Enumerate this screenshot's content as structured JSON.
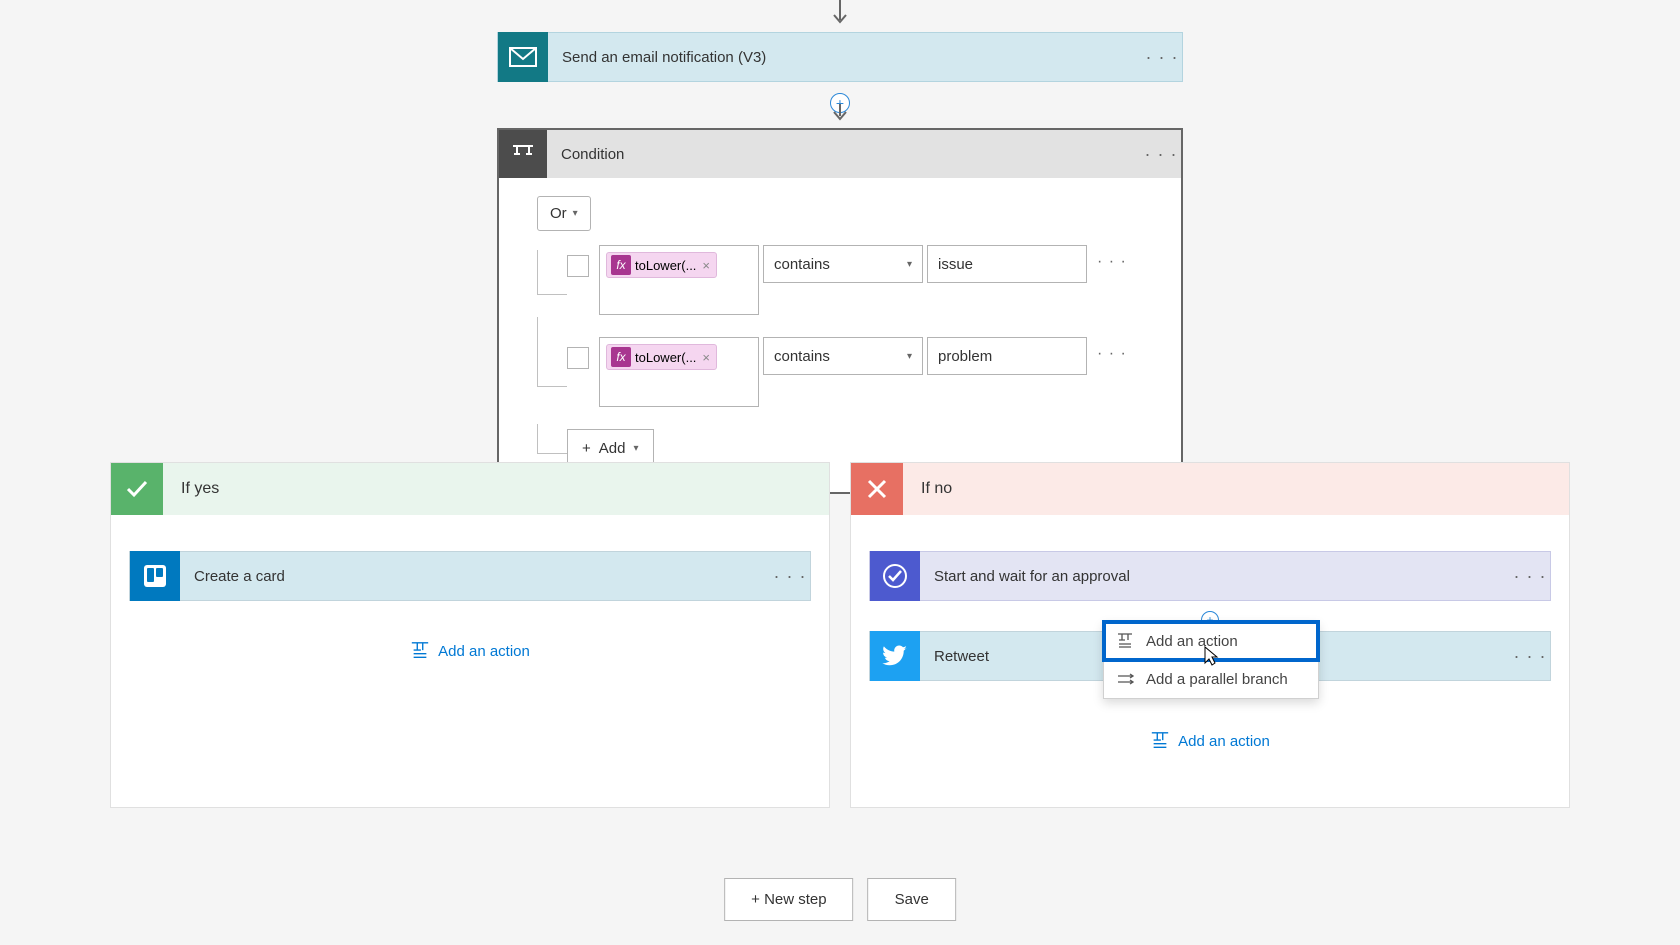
{
  "flow": {
    "step_email": "Send an email notification (V3)",
    "condition": {
      "title": "Condition",
      "logic": "Or",
      "rows": [
        {
          "pill": "toLower(...",
          "operator": "contains",
          "value": "issue"
        },
        {
          "pill": "toLower(...",
          "operator": "contains",
          "value": "problem"
        }
      ],
      "add_label": "Add"
    },
    "branches": {
      "yes": {
        "title": "If yes",
        "actions": [
          {
            "title": "Create a card"
          }
        ],
        "add_action": "Add an action"
      },
      "no": {
        "title": "If no",
        "actions": [
          {
            "title": "Start and wait for an approval"
          },
          {
            "title": "Retweet"
          }
        ],
        "add_action": "Add an action"
      }
    },
    "popup": {
      "add_action": "Add an action",
      "add_parallel": "Add a parallel branch"
    },
    "footer": {
      "new_step": "+ New step",
      "save": "Save"
    }
  }
}
